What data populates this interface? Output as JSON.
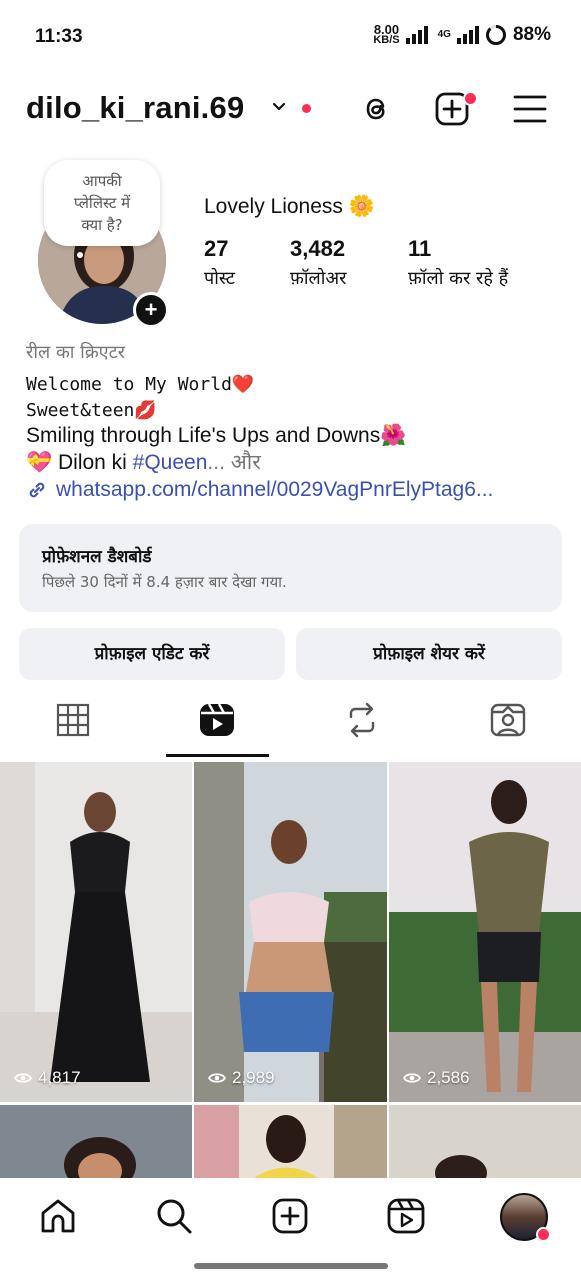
{
  "status_bar": {
    "time": "11:33",
    "speed_value": "8.00",
    "speed_unit": "KB/S",
    "network": "4G",
    "battery": "88%"
  },
  "header": {
    "username": "dilo_ki_rani.69",
    "icons": [
      "chevron-down-icon",
      "threads-icon",
      "create-post-icon",
      "menu-icon"
    ]
  },
  "profile": {
    "note_bubble": [
      "आपकी",
      "प्लेलिस्ट में",
      "क्या है?"
    ],
    "display_name": "Lovely Lioness 🌼",
    "stats": [
      {
        "value": "27",
        "label": "पोस्ट"
      },
      {
        "value": "3,482",
        "label": "फ़ॉलोअर"
      },
      {
        "value": "11",
        "label": "फ़ॉलो कर रहे हैं"
      }
    ],
    "category": "रील का क्रिएटर",
    "bio": {
      "line1": "Welcome to My World❤️",
      "line2": "Sweet&teen💋",
      "line3": "Smiling through Life's Ups and Downs🌺",
      "line4_prefix": "💝 Dilon ki ",
      "line4_hashtag": "#Queen",
      "line4_more": "... और"
    },
    "link": "whatsapp.com/channel/0029VagPnrElyPtag6..."
  },
  "dashboard": {
    "title": "प्रोफ़ेशनल डैशबोर्ड",
    "subtitle": "पिछले 30 दिनों में 8.4 हज़ार बार देखा गया."
  },
  "buttons": {
    "edit_profile": "प्रोफ़ाइल एडिट करें",
    "share_profile": "प्रोफ़ाइल शेयर करें"
  },
  "tabs": {
    "items": [
      "grid-icon",
      "reels-icon",
      "reposts-icon",
      "tagged-icon"
    ],
    "selected": "reels-icon"
  },
  "grid": {
    "reels": [
      {
        "views": "4,817"
      },
      {
        "views": "2,989"
      },
      {
        "views": "2,586"
      }
    ]
  },
  "bottom_nav": {
    "items": [
      "home-icon",
      "search-icon",
      "create-icon",
      "reels-icon",
      "profile-avatar"
    ]
  },
  "colors": {
    "accent_red": "#ff2d55",
    "link_blue": "#3b4fb5",
    "button_bg": "#eff1f5"
  }
}
